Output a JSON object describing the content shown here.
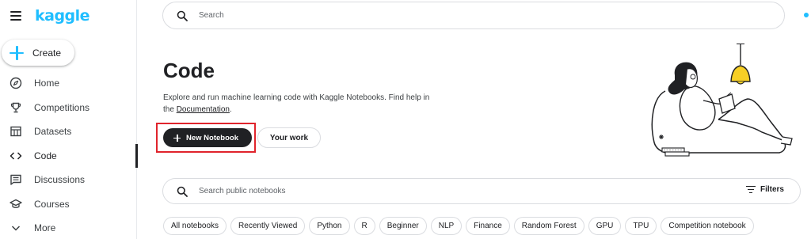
{
  "brand": {
    "logo_text": "kaggle",
    "accent_color": "#20beff"
  },
  "sidebar": {
    "create_label": "Create",
    "items": [
      {
        "label": "Home",
        "icon": "compass-icon",
        "active": false
      },
      {
        "label": "Competitions",
        "icon": "trophy-icon",
        "active": false
      },
      {
        "label": "Datasets",
        "icon": "table-icon",
        "active": false
      },
      {
        "label": "Code",
        "icon": "code-icon",
        "active": true
      },
      {
        "label": "Discussions",
        "icon": "comment-icon",
        "active": false
      },
      {
        "label": "Courses",
        "icon": "school-icon",
        "active": false
      },
      {
        "label": "More",
        "icon": "chevron-down-icon",
        "active": false
      }
    ]
  },
  "header": {
    "search_placeholder": "Search"
  },
  "hero": {
    "title": "Code",
    "description_prefix": "Explore and run machine learning code with Kaggle Notebooks. Find help in the ",
    "description_link": "Documentation",
    "description_suffix": ".",
    "new_notebook_label": "New Notebook",
    "your_work_label": "Your work",
    "highlight_color": "#e0242c"
  },
  "notebook_search": {
    "placeholder": "Search public notebooks",
    "filters_label": "Filters"
  },
  "chips": [
    "All notebooks",
    "Recently Viewed",
    "Python",
    "R",
    "Beginner",
    "NLP",
    "Finance",
    "Random Forest",
    "GPU",
    "TPU",
    "Competition notebook"
  ]
}
